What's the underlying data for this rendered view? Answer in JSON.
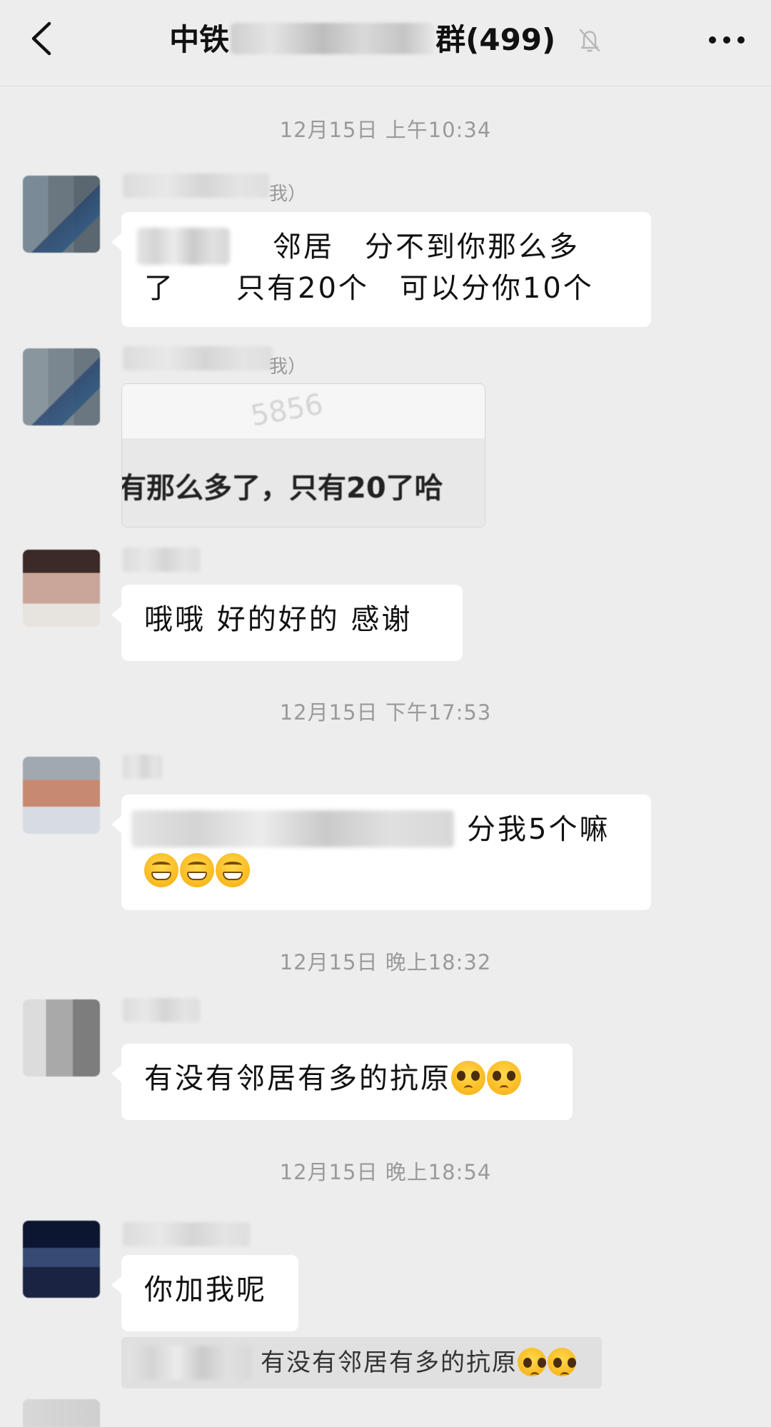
{
  "header": {
    "title_prefix": "中铁",
    "title_suffix": "群(499)"
  },
  "messages": {
    "m1": {
      "sender_suffix": "我）",
      "line1_text": "邻居　分不到你那么多",
      "line2_text": "了　　只有20个　可以分你10个"
    },
    "m2": {
      "sender_suffix": "我）",
      "image_watermark": "5856",
      "image_text": "有那么多了，只有20了哈"
    },
    "m3": {
      "text": "哦哦  好的好的  感谢"
    },
    "m4": {
      "text": "分我5个嘛"
    },
    "m5": {
      "text": "有没有邻居有多的抗原"
    },
    "m6": {
      "text": "你加我呢"
    }
  },
  "timestamps": {
    "t1": "12月15日  上午10:34",
    "t2": "12月15日  下午17:53",
    "t3": "12月15日  晚上18:32",
    "t4": "12月15日  晚上18:54"
  },
  "quote": {
    "text": "有没有邻居有多的抗原"
  },
  "icons": {
    "back": "chevron-left-icon",
    "mute": "bell-off-icon",
    "more": "more-dots-icon",
    "grin": "grinning-face-emoji",
    "plead": "pleading-face-emoji"
  },
  "colors": {
    "background": "#ededed",
    "bubble": "#ffffff",
    "timestamp": "#9a9a9a"
  }
}
